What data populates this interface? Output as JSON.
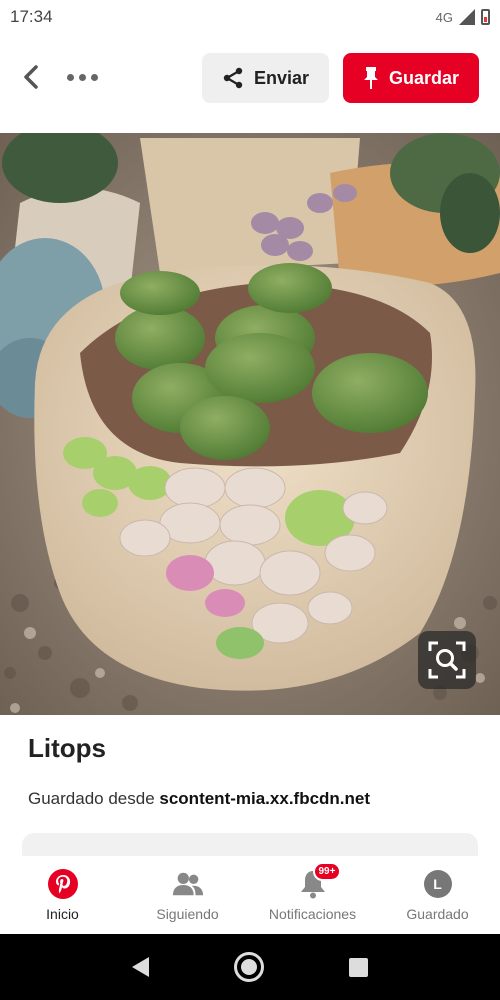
{
  "status_bar": {
    "time": "17:34",
    "network": "4G"
  },
  "toolbar": {
    "send_label": "Enviar",
    "save_label": "Guardar"
  },
  "pin": {
    "title": "Litops",
    "source_prefix": "Guardado desde ",
    "source_domain": "scontent-mia.xx.fbcdn.net"
  },
  "bottom_nav": {
    "items": [
      {
        "label": "Inicio",
        "icon": "pinterest-logo-icon",
        "active": true
      },
      {
        "label": "Siguiendo",
        "icon": "people-icon"
      },
      {
        "label": "Notificaciones",
        "icon": "bell-icon",
        "badge": "99+"
      },
      {
        "label": "Guardado",
        "icon": "avatar-icon",
        "avatar_letter": "L"
      }
    ]
  },
  "colors": {
    "brand_red": "#e60023",
    "send_bg": "#efefef"
  }
}
